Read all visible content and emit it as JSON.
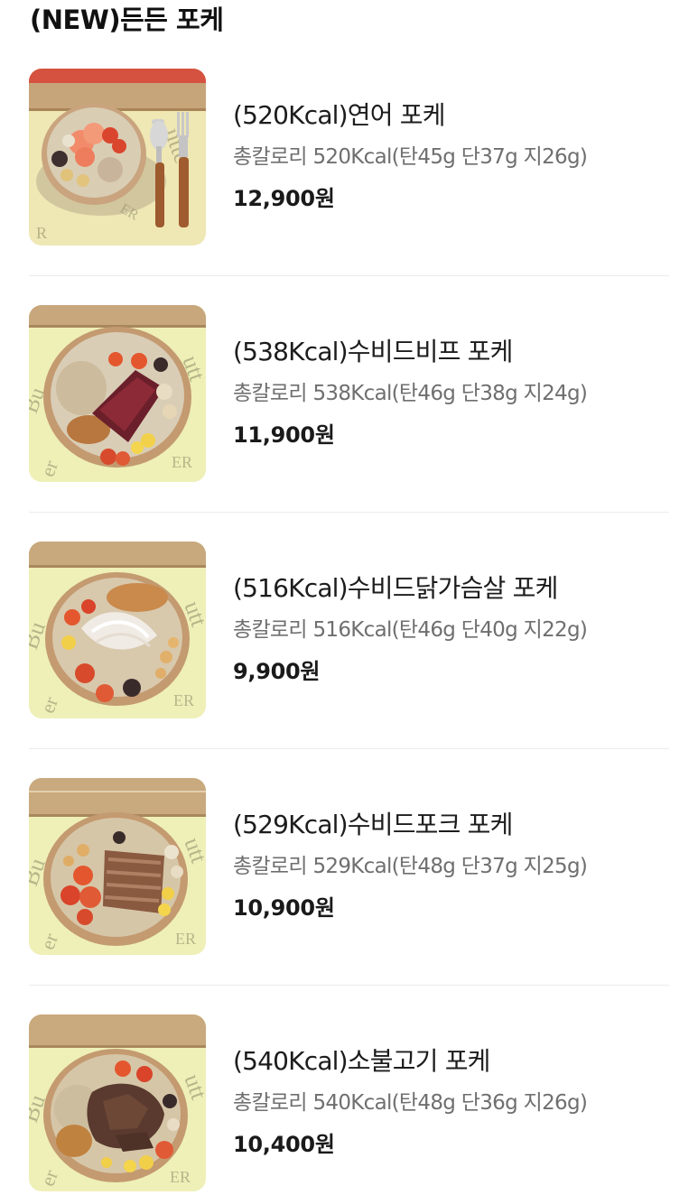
{
  "section": {
    "title": "(NEW)든든 포케"
  },
  "menu_items": [
    {
      "name": "(520Kcal)연어 포케",
      "description": "총칼로리 520Kcal(탄45g 단37g 지26g)",
      "price": "12,900원",
      "image": "salmon-poke-bowl-photo"
    },
    {
      "name": "(538Kcal)수비드비프 포케",
      "description": "총칼로리 538Kcal(탄46g 단38g 지24g)",
      "price": "11,900원",
      "image": "sous-vide-beef-poke-bowl-photo"
    },
    {
      "name": "(516Kcal)수비드닭가슴살 포케",
      "description": "총칼로리 516Kcal(탄46g 단40g 지22g)",
      "price": "9,900원",
      "image": "sous-vide-chicken-breast-poke-bowl-photo"
    },
    {
      "name": "(529Kcal)수비드포크 포케",
      "description": "총칼로리 529Kcal(탄48g 단37g 지25g)",
      "price": "10,900원",
      "image": "sous-vide-pork-poke-bowl-photo"
    },
    {
      "name": "(540Kcal)소불고기 포케",
      "description": "총칼로리 540Kcal(탄48g 단36g 지26g)",
      "price": "10,400원",
      "image": "beef-bulgogi-poke-bowl-photo"
    }
  ],
  "colors": {
    "title_text": "#111111",
    "name_text": "#1c1c1c",
    "description_text": "#6f6f6f",
    "price_text": "#1a1a1a",
    "divider": "#ececec"
  }
}
